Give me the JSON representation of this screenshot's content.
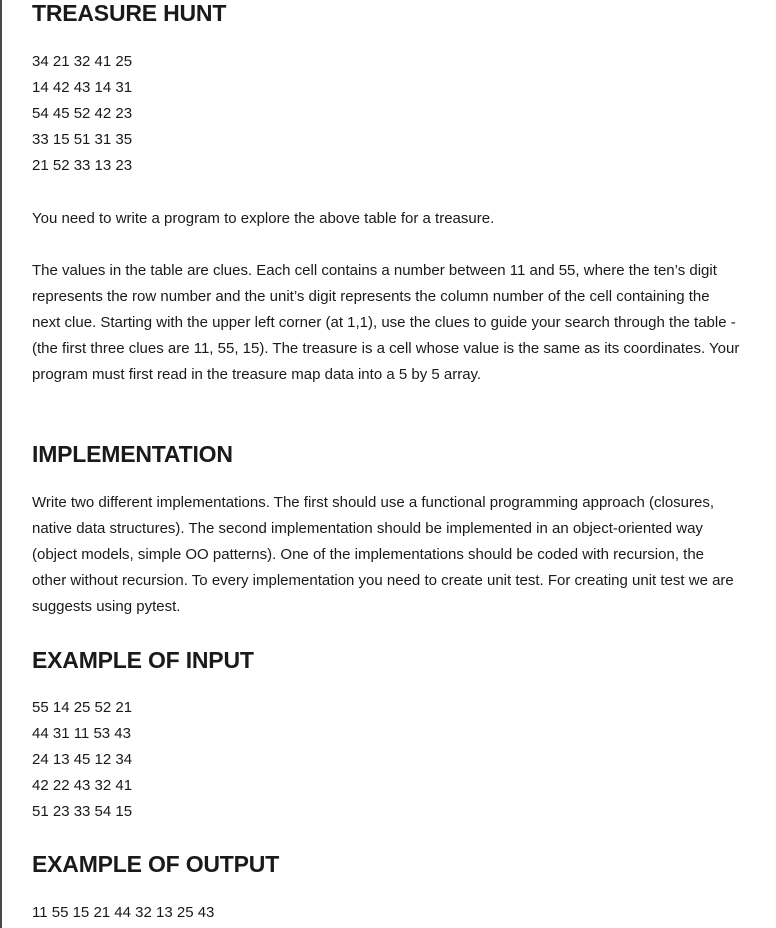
{
  "sections": {
    "treasure_hunt": {
      "title": "TREASURE HUNT",
      "table_rows": [
        "34 21 32 41 25",
        "14 42 43 14 31",
        "54 45 52 42 23",
        "33 15 51 31 35",
        "21 52 33 13 23"
      ],
      "intro": "You need to write a program to explore the above table for a treasure.",
      "description": "The values in the table are clues. Each cell contains a number between 11 and 55, where the ten’s digit represents the row number and the unit’s digit represents the column number of the cell containing the next clue. Starting with the upper left corner (at 1,1), use the clues to guide your search through the table - (the first three clues are 11, 55, 15). The treasure is a cell whose value is the same as its coordinates. Your program must first read in the treasure map data into a 5 by 5 array."
    },
    "implementation": {
      "title": "IMPLEMENTATION",
      "text": "Write two different implementations. The first should use a functional programming approach (closures, native data structures). The second implementation should be implemented in an object-oriented way (object models, simple OO patterns). One of the implementations should be coded with recursion, the other without recursion. To every implementation you need to create unit test. For creating unit test we are suggests using pytest."
    },
    "example_input": {
      "title": "EXAMPLE OF INPUT",
      "rows": [
        "55 14 25 52 21",
        "44 31 11 53 43",
        "24 13 45 12 34",
        "42 22 43 32 41",
        "51 23 33 54 15"
      ]
    },
    "example_output": {
      "title": "EXAMPLE OF OUTPUT",
      "text": "11 55 15 21 44 32 13 25 43"
    }
  }
}
